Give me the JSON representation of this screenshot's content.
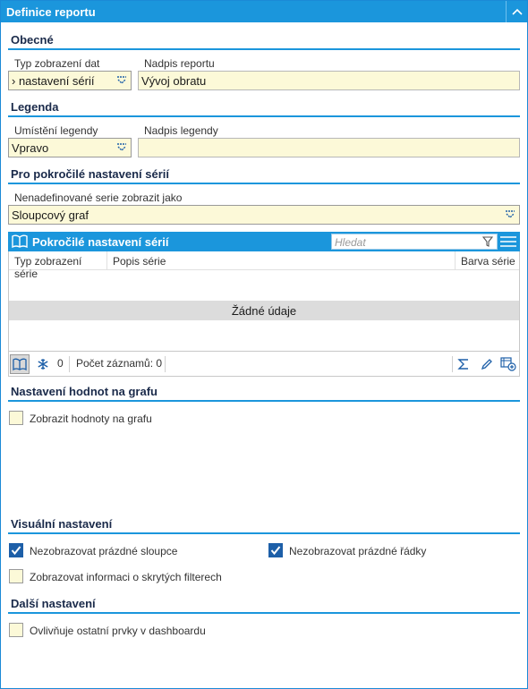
{
  "window": {
    "title": "Definice reportu"
  },
  "general": {
    "heading": "Obecné",
    "display_type_label": "Typ zobrazení dat",
    "display_type_value": "› nastavení sérií",
    "report_caption_label": "Nadpis reportu",
    "report_caption_value": "Vývoj obratu"
  },
  "legend": {
    "heading": "Legenda",
    "position_label": "Umístění legendy",
    "position_value": "Vpravo",
    "caption_label": "Nadpis legendy",
    "caption_value": ""
  },
  "advanced": {
    "heading": "Pro pokročilé nastavení sérií",
    "undefined_series_label": "Nenadefinované serie zobrazit jako",
    "undefined_series_value": "Sloupcový graf"
  },
  "grid": {
    "title": "Pokročilé nastavení sérií",
    "search_placeholder": "Hledat",
    "columns": [
      "Typ zobrazení série",
      "Popis série",
      "Barva série"
    ],
    "empty_text": "Žádné údaje",
    "frozen_count": "0",
    "record_count": "Počet záznamů: 0"
  },
  "chart_values": {
    "heading": "Nastavení hodnot na grafu",
    "show_values_label": "Zobrazit hodnoty na grafu",
    "show_values_checked": false
  },
  "visual": {
    "heading": "Visuální nastavení",
    "hide_empty_columns_label": "Nezobrazovat prázdné sloupce",
    "hide_empty_columns_checked": true,
    "hide_empty_rows_label": "Nezobrazovat prázdné řádky",
    "hide_empty_rows_checked": true,
    "show_hidden_filters_label": "Zobrazovat informaci o skrytých filterech",
    "show_hidden_filters_checked": false
  },
  "other": {
    "heading": "Další nastavení",
    "affects_dashboard_label": "Ovlivňuje ostatní prvky v dashboardu",
    "affects_dashboard_checked": false
  },
  "colors": {
    "accent": "#1b96dc",
    "field_bg": "#fcf9d8",
    "check": "#1d5fa8"
  }
}
